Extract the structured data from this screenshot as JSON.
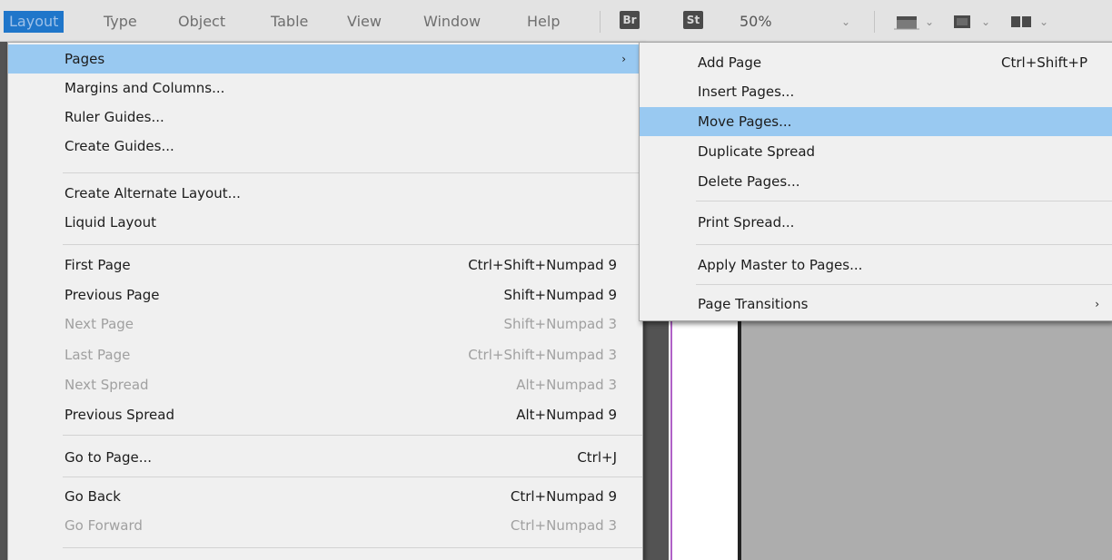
{
  "menubar": {
    "items": [
      "Layout",
      "Type",
      "Object",
      "Table",
      "View",
      "Window",
      "Help"
    ],
    "bridge_badge": "Br",
    "stock_badge": "St",
    "zoom": "50%"
  },
  "layout_menu": {
    "items": [
      {
        "label": "Pages",
        "shortcut": "",
        "submenu_arrow": "›"
      },
      {
        "label": "Margins and Columns...",
        "shortcut": ""
      },
      {
        "label": "Ruler Guides...",
        "shortcut": ""
      },
      {
        "label": "Create Guides...",
        "shortcut": ""
      },
      {
        "label": "Create Alternate Layout...",
        "shortcut": ""
      },
      {
        "label": "Liquid Layout",
        "shortcut": ""
      },
      {
        "label": "First Page",
        "shortcut": "Ctrl+Shift+Numpad 9"
      },
      {
        "label": "Previous Page",
        "shortcut": "Shift+Numpad 9"
      },
      {
        "label": "Next Page",
        "shortcut": "Shift+Numpad 3"
      },
      {
        "label": "Last Page",
        "shortcut": "Ctrl+Shift+Numpad 3"
      },
      {
        "label": "Next Spread",
        "shortcut": "Alt+Numpad 3"
      },
      {
        "label": "Previous Spread",
        "shortcut": "Alt+Numpad 9"
      },
      {
        "label": "Go to Page...",
        "shortcut": "Ctrl+J"
      },
      {
        "label": "Go Back",
        "shortcut": "Ctrl+Numpad 9"
      },
      {
        "label": "Go Forward",
        "shortcut": "Ctrl+Numpad 3"
      }
    ]
  },
  "pages_submenu": {
    "items": [
      {
        "label": "Add Page",
        "shortcut": "Ctrl+Shift+P"
      },
      {
        "label": "Insert Pages...",
        "shortcut": ""
      },
      {
        "label": "Move Pages...",
        "shortcut": ""
      },
      {
        "label": "Duplicate Spread",
        "shortcut": ""
      },
      {
        "label": "Delete Pages...",
        "shortcut": ""
      },
      {
        "label": "Print Spread...",
        "shortcut": ""
      },
      {
        "label": "Apply Master to Pages...",
        "shortcut": ""
      },
      {
        "label": "Page Transitions",
        "shortcut": "",
        "submenu_arrow": "›"
      }
    ]
  },
  "icons": {
    "zoom_dropdown": "chevron-down-icon",
    "screen_mode": "screen-mode-icon",
    "view_options": "view-options-icon",
    "arrange_documents": "arrange-documents-icon"
  },
  "colors": {
    "menubar_bg": "#e3e3e3",
    "menubar_active": "#1f76ca",
    "menu_bg": "#f0f0f0",
    "menu_highlight": "#99c9f1",
    "disabled_text": "#a0a0a0",
    "pasteboard": "#adadad",
    "guide": "#b061c7"
  }
}
